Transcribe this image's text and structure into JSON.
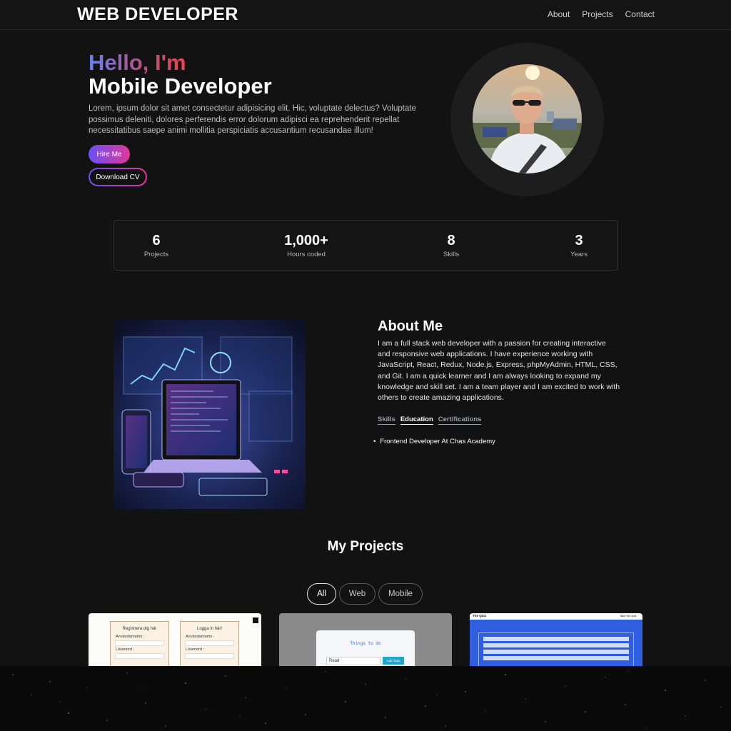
{
  "nav": {
    "brand": "WEB DEVELOPER",
    "links": [
      "About",
      "Projects",
      "Contact"
    ]
  },
  "hero": {
    "greeting": "Hello, I'm",
    "role": "Mobile Developer",
    "description": "Lorem, ipsum dolor sit amet consectetur adipisicing elit. Hic, voluptate delectus? Voluptate possimus deleniti, dolores perferendis error dolorum adipisci ea reprehenderit repellat necessitatibus saepe animi mollitia perspiciatis accusantium recusandae illum!",
    "hire_label": "Hire Me",
    "cv_label": "Download CV"
  },
  "stats": [
    {
      "value": "6",
      "label": "Projects"
    },
    {
      "value": "1,000+",
      "label": "Hours coded"
    },
    {
      "value": "8",
      "label": "Skills"
    },
    {
      "value": "3",
      "label": "Years"
    }
  ],
  "about": {
    "title": "About Me",
    "text": "I am a full stack web developer with a passion for creating interactive and responsive web applications. I have experience working with JavaScript, React, Redux, Node.js, Express, phpMyAdmin, HTML, CSS, and Git. I am a quick learner and I am always looking to expand my knowledge and skill set. I am a team player and I am excited to work with others to create amazing applications.",
    "tabs": [
      "Skills",
      "Education",
      "Certifications"
    ],
    "active_tab": "Education",
    "items": [
      "Frontend Developer At Chas Academy"
    ]
  },
  "projects": {
    "title": "My Projects",
    "filters": [
      "All",
      "Web",
      "Mobile"
    ],
    "active_filter": "All",
    "card1": {
      "register_title": "Registrera dig här",
      "login_title": "Logga in här!",
      "username_label": "Användarnamn :",
      "password_label": "Lösenord :"
    },
    "card2": {
      "title": "Things to do",
      "input_value": "Read",
      "button": "Add Todo"
    },
    "card3": {
      "brand": "The Quiz",
      "nav_item": "Take the quiz"
    }
  },
  "colors": {
    "background": "#121212",
    "accent_start": "#6a4ff5",
    "accent_end": "#e0379a",
    "greeting_start": "#6a82f0",
    "greeting_end": "#f0434b"
  }
}
